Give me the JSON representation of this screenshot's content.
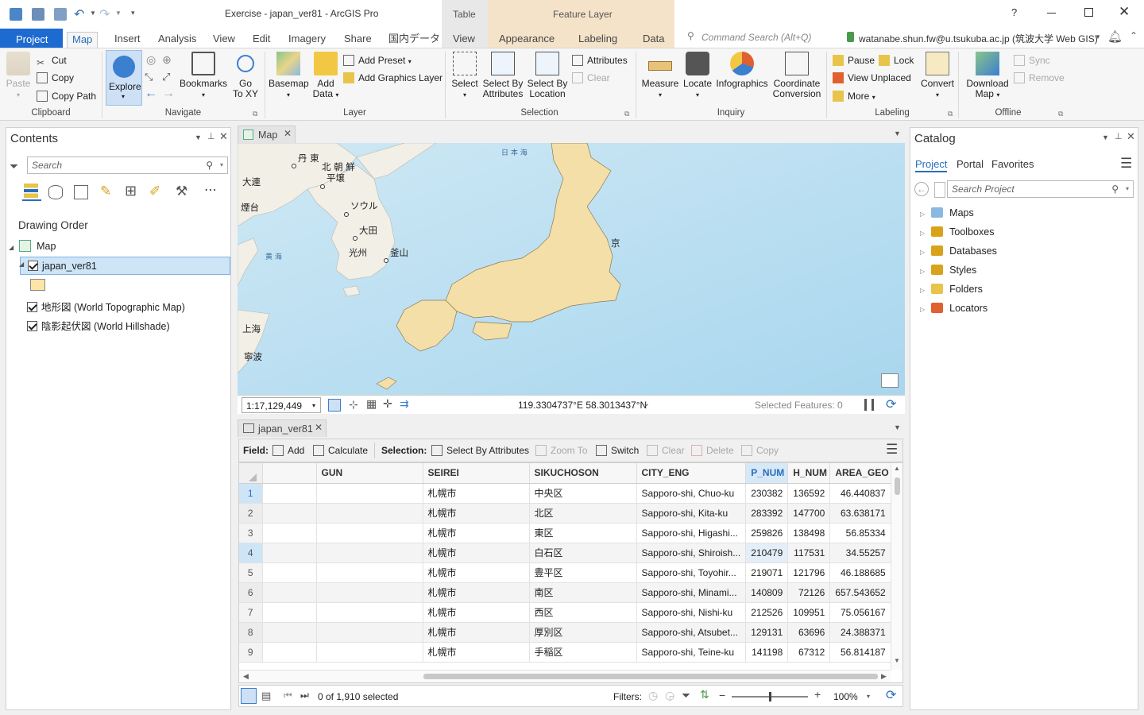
{
  "title": "Exercise - japan_ver81 - ArcGIS Pro",
  "context_tabs": {
    "table": "Table",
    "feature_layer": "Feature Layer"
  },
  "window": {
    "help": "?"
  },
  "tabs": [
    "Project",
    "Map",
    "Insert",
    "Analysis",
    "View",
    "Edit",
    "Imagery",
    "Share",
    "国内データ",
    "View",
    "Appearance",
    "Labeling",
    "Data"
  ],
  "command_search": "Command Search (Alt+Q)",
  "user": "watanabe.shun.fw@u.tsukuba.ac.jp (筑波大学 Web GIS)",
  "ribbon": {
    "clipboard": {
      "label": "Clipboard",
      "paste": "Paste",
      "cut": "Cut",
      "copy": "Copy",
      "copy_path": "Copy Path"
    },
    "navigate": {
      "label": "Navigate",
      "explore": "Explore",
      "bookmarks": "Bookmarks",
      "goto": "Go",
      "goto2": "To XY"
    },
    "layer": {
      "label": "Layer",
      "basemap": "Basemap",
      "add_data": "Add",
      "add_data2": "Data",
      "add_preset": "Add Preset",
      "add_graphics": "Add Graphics Layer"
    },
    "selection": {
      "label": "Selection",
      "select": "Select",
      "select_attr": "Select By",
      "select_attr2": "Attributes",
      "select_loc": "Select By",
      "select_loc2": "Location",
      "attributes": "Attributes",
      "clear": "Clear"
    },
    "inquiry": {
      "label": "Inquiry",
      "measure": "Measure",
      "locate": "Locate",
      "infographics": "Infographics",
      "coord": "Coordinate",
      "coord2": "Conversion"
    },
    "labeling": {
      "label": "Labeling",
      "pause": "Pause",
      "lock": "Lock",
      "view_unplaced": "View Unplaced",
      "more": "More",
      "convert": "Convert"
    },
    "offline": {
      "label": "Offline",
      "download": "Download",
      "download2": "Map",
      "sync": "Sync",
      "remove": "Remove"
    }
  },
  "contents": {
    "title": "Contents",
    "search_placeholder": "Search",
    "drawing_order": "Drawing Order",
    "map": "Map",
    "layer": "japan_ver81",
    "basemap1": "地形図 (World Topographic Map)",
    "basemap2": "陰影起伏図 (World Hillshade)"
  },
  "map_view": {
    "tab": "Map",
    "scale": "1:17,129,449",
    "coords": "119.3304737°E 58.3013437°N",
    "selected": "Selected Features: 0",
    "labels": {
      "sea_japan": "日 本 海",
      "dandong": "丹 東",
      "dalian": "大連",
      "nk": "北 朝 鮮",
      "pyongyang": "平壌",
      "yantai": "煙台",
      "seoul": "ソウル",
      "daejeon": "大田",
      "gwangju": "光州",
      "busan": "釜山",
      "yellow_sea": "黄 海",
      "shanghai": "上海",
      "ningbo": "寧波",
      "tokyo": "京"
    }
  },
  "table": {
    "tab": "japan_ver81",
    "field_label": "Field:",
    "add": "Add",
    "calculate": "Calculate",
    "selection_label": "Selection:",
    "select_by_attr": "Select By Attributes",
    "zoom_to": "Zoom To",
    "switch": "Switch",
    "clear": "Clear",
    "delete": "Delete",
    "copy": "Copy",
    "columns": [
      "",
      "GUN",
      "SEIREI",
      "SIKUCHOSON",
      "CITY_ENG",
      "P_NUM",
      "H_NUM",
      "AREA_GEO"
    ],
    "rows": [
      {
        "n": "1",
        "gun": "",
        "seirei": "札幌市",
        "sik": "中央区",
        "city": "Sapporo-shi, Chuo-ku",
        "p": "230382",
        "h": "136592",
        "area": "46.440837"
      },
      {
        "n": "2",
        "gun": "",
        "seirei": "札幌市",
        "sik": "北区",
        "city": "Sapporo-shi, Kita-ku",
        "p": "283392",
        "h": "147700",
        "area": "63.638171"
      },
      {
        "n": "3",
        "gun": "",
        "seirei": "札幌市",
        "sik": "東区",
        "city": "Sapporo-shi, Higashi...",
        "p": "259826",
        "h": "138498",
        "area": "56.85334"
      },
      {
        "n": "4",
        "gun": "",
        "seirei": "札幌市",
        "sik": "白石区",
        "city": "Sapporo-shi, Shiroish...",
        "p": "210479",
        "h": "117531",
        "area": "34.55257"
      },
      {
        "n": "5",
        "gun": "",
        "seirei": "札幌市",
        "sik": "豊平区",
        "city": "Sapporo-shi, Toyohir...",
        "p": "219071",
        "h": "121796",
        "area": "46.188685"
      },
      {
        "n": "6",
        "gun": "",
        "seirei": "札幌市",
        "sik": "南区",
        "city": "Sapporo-shi, Minami...",
        "p": "140809",
        "h": "72126",
        "area": "657.543652"
      },
      {
        "n": "7",
        "gun": "",
        "seirei": "札幌市",
        "sik": "西区",
        "city": "Sapporo-shi, Nishi-ku",
        "p": "212526",
        "h": "109951",
        "area": "75.056167"
      },
      {
        "n": "8",
        "gun": "",
        "seirei": "札幌市",
        "sik": "厚別区",
        "city": "Sapporo-shi, Atsubet...",
        "p": "129131",
        "h": "63696",
        "area": "24.388371"
      },
      {
        "n": "9",
        "gun": "",
        "seirei": "札幌市",
        "sik": "手稲区",
        "city": "Sapporo-shi, Teine-ku",
        "p": "141198",
        "h": "67312",
        "area": "56.814187"
      }
    ],
    "footer_selected": "0 of 1,910 selected",
    "filters": "Filters:",
    "zoom": "100%"
  },
  "catalog": {
    "title": "Catalog",
    "tabs": [
      "Project",
      "Portal",
      "Favorites"
    ],
    "search_placeholder": "Search Project",
    "items": [
      "Maps",
      "Toolboxes",
      "Databases",
      "Styles",
      "Folders",
      "Locators"
    ]
  },
  "colors": {
    "accent": "#2a6ebb",
    "feature_fill": "#f4dfa8",
    "water": "#bfe1f2"
  }
}
